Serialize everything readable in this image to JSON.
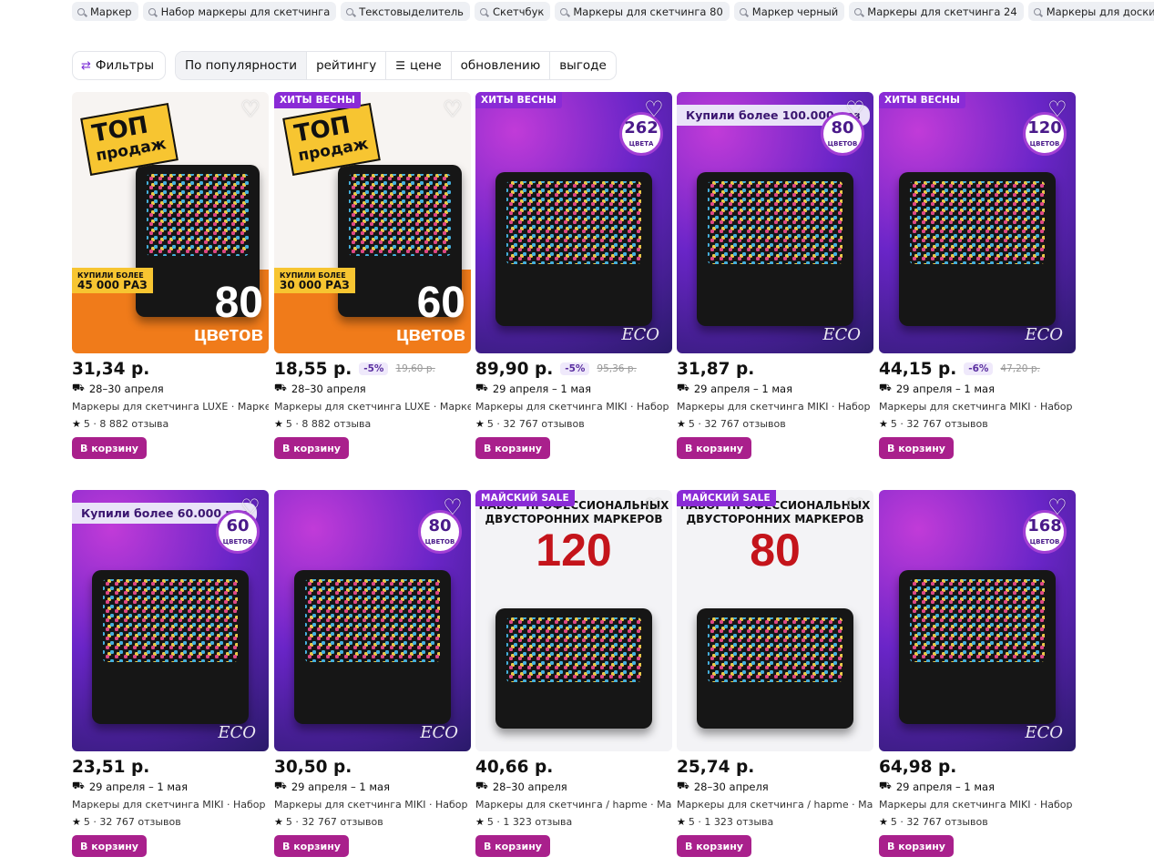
{
  "search_chips": [
    "Маркер",
    "Набор маркеры для скетчинга",
    "Текстовыделитель",
    "Скетчбук",
    "Маркеры для скетчинга 80",
    "Маркер черный",
    "Маркеры для скетчинга 24",
    "Маркеры для доски"
  ],
  "sort": {
    "filters_label": "Фильтры",
    "options": [
      "По популярности",
      "рейтингу",
      "цене",
      "обновлению",
      "выгоде"
    ]
  },
  "cart_label": "В корзину",
  "products": [
    {
      "badge": "",
      "price": "31,34 р.",
      "discount": "",
      "old_price": "",
      "delivery": "28–30 апреля",
      "title": "Маркеры для скетчинга LUXE · Маркеры",
      "rating": "5",
      "reviews": "8 882 отзыва",
      "poster_top": "ТОП",
      "poster_sub": "продаж",
      "bought_small": "КУПИЛИ БОЛЕЕ",
      "bought_big": "45 000 РАЗ",
      "count": "80",
      "count_unit": "цветов"
    },
    {
      "badge": "ХИТЫ ВЕСНЫ",
      "price": "18,55 р.",
      "discount": "-5%",
      "old_price": "19,60 р.",
      "delivery": "28–30 апреля",
      "title": "Маркеры для скетчинга LUXE · Маркеры",
      "rating": "5",
      "reviews": "8 882 отзыва",
      "poster_top": "ТОП",
      "poster_sub": "продаж",
      "bought_small": "КУПИЛИ БОЛЕЕ",
      "bought_big": "30 000 РАЗ",
      "count": "60",
      "count_unit": "цветов"
    },
    {
      "badge": "ХИТЫ ВЕСНЫ",
      "price": "89,90 р.",
      "discount": "-5%",
      "old_price": "95,36 р.",
      "delivery": "29 апреля – 1 мая",
      "title": "Маркеры для скетчинга MIKI · Набор мар",
      "rating": "5",
      "reviews": "32 767 отзывов",
      "count": "262",
      "count_unit": "ЦВЕТА",
      "logo": "ECO"
    },
    {
      "badge": "",
      "price": "31,87 р.",
      "discount": "",
      "old_price": "",
      "delivery": "29 апреля – 1 мая",
      "title": "Маркеры для скетчинга MIKI · Набор мар",
      "rating": "5",
      "reviews": "32 767 отзывов",
      "pill": "Купили более 100.000 раз",
      "count": "80",
      "count_unit": "ЦВЕТОВ",
      "logo": "ECO"
    },
    {
      "badge": "ХИТЫ ВЕСНЫ",
      "price": "44,15 р.",
      "discount": "-6%",
      "old_price": "47,20 р.",
      "delivery": "29 апреля – 1 мая",
      "title": "Маркеры для скетчинга MIKI · Набор мар",
      "rating": "5",
      "reviews": "32 767 отзывов",
      "count": "120",
      "count_unit": "ЦВЕТОВ",
      "logo": "ECO"
    },
    {
      "badge": "",
      "price": "23,51 р.",
      "discount": "",
      "old_price": "",
      "delivery": "29 апреля – 1 мая",
      "title": "Маркеры для скетчинга MIKI · Набор мар",
      "rating": "5",
      "reviews": "32 767 отзывов",
      "pill": "Купили более 60.000 раз",
      "count": "60",
      "count_unit": "ЦВЕТОВ",
      "logo": "ECO"
    },
    {
      "badge": "",
      "price": "30,50 р.",
      "discount": "",
      "old_price": "",
      "delivery": "29 апреля – 1 мая",
      "title": "Маркеры для скетчинга MIKI · Набор мар",
      "rating": "5",
      "reviews": "32 767 отзывов",
      "count": "80",
      "count_unit": "ЦВЕТОВ",
      "logo": "ECO"
    },
    {
      "badge": "МАЙСКИЙ SALE",
      "price": "40,66 р.",
      "discount": "",
      "old_price": "",
      "delivery": "28–30 апреля",
      "title": "Маркеры для скетчинга / hapme · Маркер",
      "rating": "5",
      "reviews": "1 323 отзыва",
      "poster_title": "НАБОР ПРОФЕССИОНАЛЬНЫХ ДВУСТОРОННИХ МАРКЕРОВ",
      "poster_num": "120"
    },
    {
      "badge": "МАЙСКИЙ SALE",
      "price": "25,74 р.",
      "discount": "",
      "old_price": "",
      "delivery": "28–30 апреля",
      "title": "Маркеры для скетчинга / hapme · Маркер",
      "rating": "5",
      "reviews": "1 323 отзыва",
      "poster_title": "НАБОР ПРОФЕССИОНАЛЬНЫХ ДВУСТОРОННИХ МАРКЕРОВ",
      "poster_num": "80"
    },
    {
      "badge": "",
      "price": "64,98 р.",
      "discount": "",
      "old_price": "",
      "delivery": "29 апреля – 1 мая",
      "title": "Маркеры для скетчинга MIKI · Набор мар",
      "rating": "5",
      "reviews": "32 767 отзывов",
      "count": "168",
      "count_unit": "ЦВЕТОВ",
      "logo": "ECO"
    }
  ]
}
